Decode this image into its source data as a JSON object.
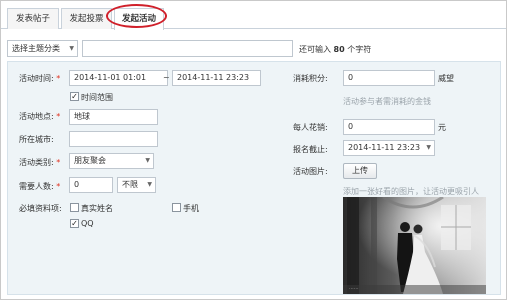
{
  "tabs": [
    {
      "label": "发表帖子"
    },
    {
      "label": "发起投票"
    },
    {
      "label": "发起活动"
    }
  ],
  "subject": {
    "category_select": "选择主题分类",
    "title_value": "",
    "hint_prefix": "还可输入",
    "hint_count": "80",
    "hint_suffix": "个字符"
  },
  "form": {
    "activity_time_label": "活动时间:",
    "start_time": "2014-11-01 01:01",
    "range_sep": "~",
    "end_time": "2014-11-11 23:23",
    "time_range_label": "时间范围",
    "location_label": "活动地点:",
    "location_value": "地球",
    "city_label": "所在城市:",
    "city_value": "",
    "category_label": "活动类别:",
    "category_value": "朋友聚会",
    "people_label": "需要人数:",
    "people_value": "0",
    "gender_value": "不限",
    "required_label": "必填资料项:",
    "realname_label": "真实姓名",
    "phone_label": "手机",
    "qq_label": "QQ",
    "credits_label": "消耗积分:",
    "credits_value": "0",
    "credits_unit": "威望",
    "credits_note": "活动参与者需消耗的金钱",
    "cost_label": "每人花销:",
    "cost_value": "0",
    "cost_unit": "元",
    "deadline_label": "报名截止:",
    "deadline_value": "2014-11-11 23:23",
    "image_label": "活动图片:",
    "upload_label": "上传",
    "image_note": "添加一张好看的图片，让活动更吸引人"
  }
}
